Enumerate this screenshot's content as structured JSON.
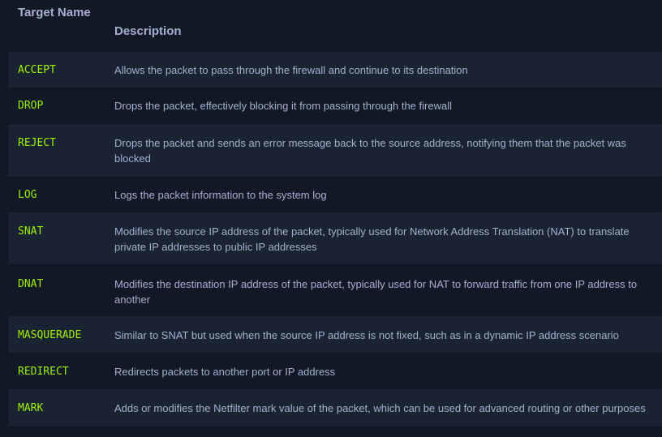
{
  "header": {
    "col_name": "Target Name",
    "col_description": "Description"
  },
  "rows": [
    {
      "name": "ACCEPT",
      "description": "Allows the packet to pass through the firewall and continue to its destination"
    },
    {
      "name": "DROP",
      "description": "Drops the packet, effectively blocking it from passing through the firewall"
    },
    {
      "name": "REJECT",
      "description": "Drops the packet and sends an error message back to the source address, notifying them that the packet was blocked"
    },
    {
      "name": "LOG",
      "description": "Logs the packet information to the system log"
    },
    {
      "name": "SNAT",
      "description": "Modifies the source IP address of the packet, typically used for Network Address Translation (NAT) to translate private IP addresses to public IP addresses"
    },
    {
      "name": "DNAT",
      "description": "Modifies the destination IP address of the packet, typically used for NAT to forward traffic from one IP address to another"
    },
    {
      "name": "MASQUERADE",
      "description": "Similar to SNAT but used when the source IP address is not fixed, such as in a dynamic IP address scenario"
    },
    {
      "name": "REDIRECT",
      "description": "Redirects packets to another port or IP address"
    },
    {
      "name": "MARK",
      "description": "Adds or modifies the Netfilter mark value of the packet, which can be used for advanced routing or other purposes"
    }
  ]
}
